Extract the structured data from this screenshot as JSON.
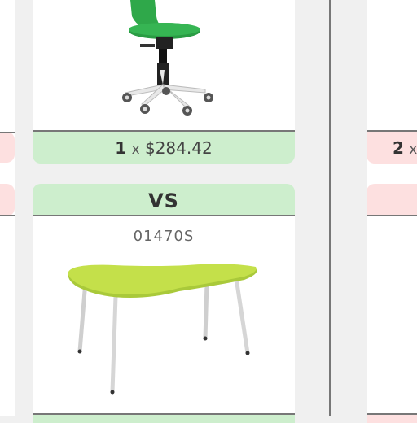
{
  "left_panel": {
    "price": {
      "quantity": "",
      "separator": "",
      "amount": ""
    }
  },
  "center_panel": {
    "product_top": {
      "image_icon": "green-office-chair",
      "price": {
        "quantity": "1",
        "separator": "x",
        "amount": "$284.42"
      }
    },
    "vs_label": "VS",
    "product_bottom": {
      "sku": "01470S",
      "image_icon": "green-kidney-table"
    }
  },
  "right_panel": {
    "price": {
      "quantity": "2",
      "separator": "x",
      "amount": ""
    }
  },
  "colors": {
    "price_bar_green": "#cdeecd",
    "price_bar_red": "#fde0e0",
    "chair_green": "#2fa84a",
    "table_green": "#c4e04a"
  }
}
